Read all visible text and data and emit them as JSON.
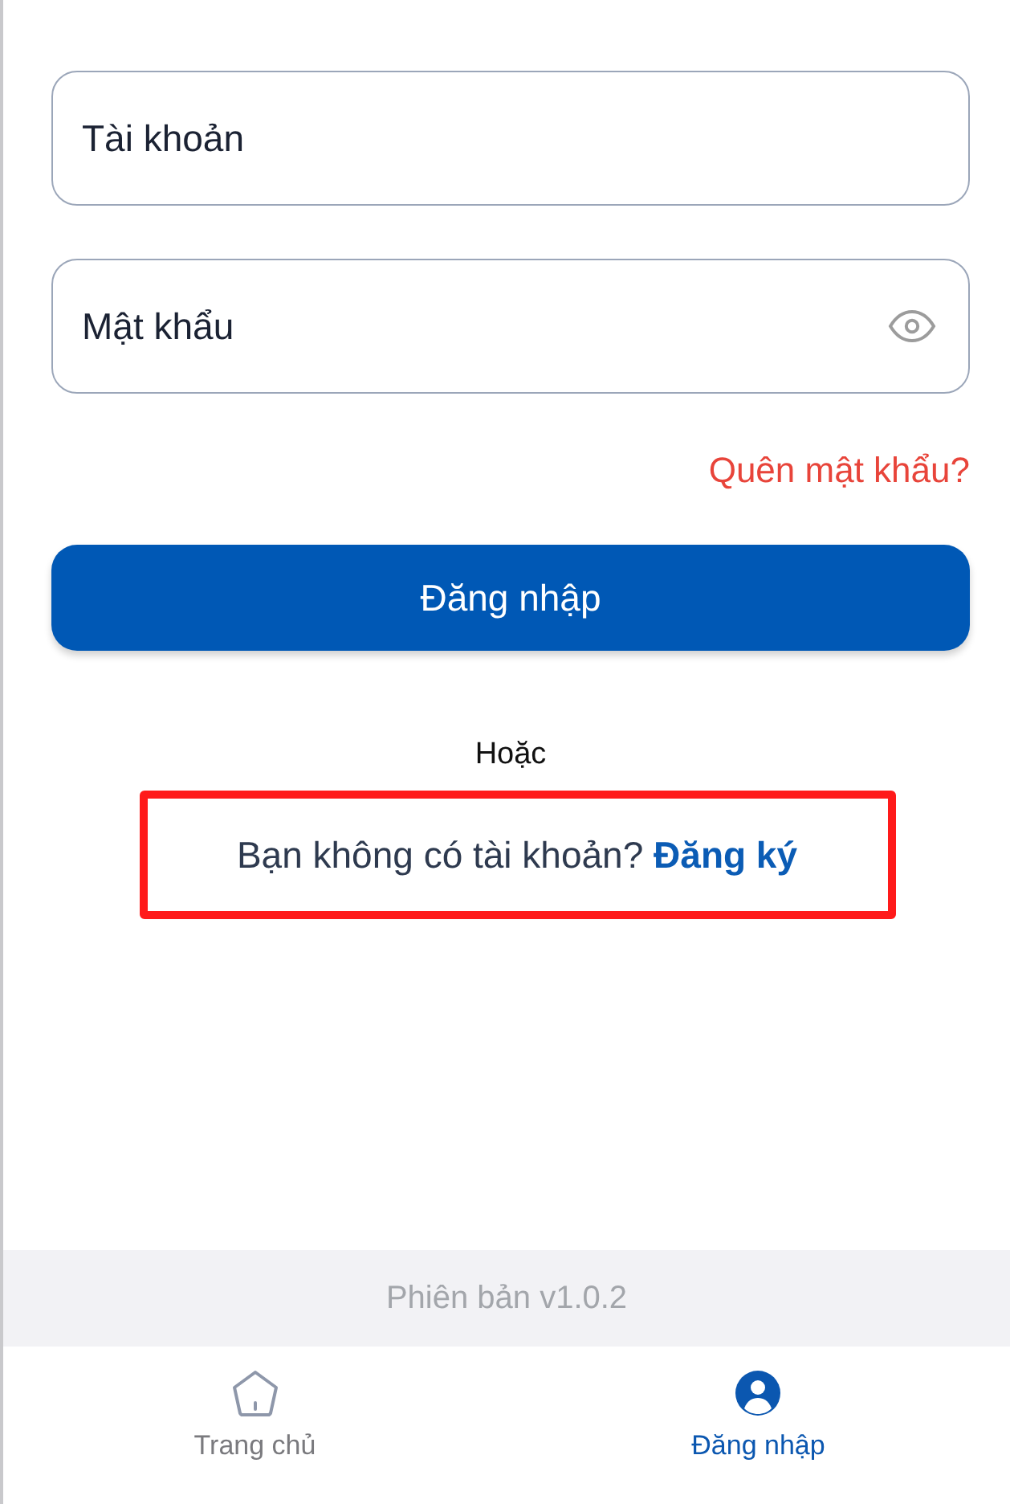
{
  "form": {
    "fields": [
      {
        "kind": "text",
        "placeholder": "Tài khoản"
      },
      {
        "kind": "password",
        "placeholder": "Mật khẩu"
      }
    ],
    "forgot_link": "Quên mật khẩu?",
    "submit_button": "Đăng nhập",
    "divider_text": "Hoặc",
    "signup_prompt": {
      "text": "Bạn không có tài khoản?",
      "link": "Đăng ký",
      "highlighted": true
    }
  },
  "version": "Phiên bản v1.0.2",
  "tab_bar": [
    {
      "kind": "home",
      "label": "Trang chủ",
      "selected": false
    },
    {
      "kind": "account",
      "label": "Đăng nhập",
      "selected": true
    }
  ]
}
